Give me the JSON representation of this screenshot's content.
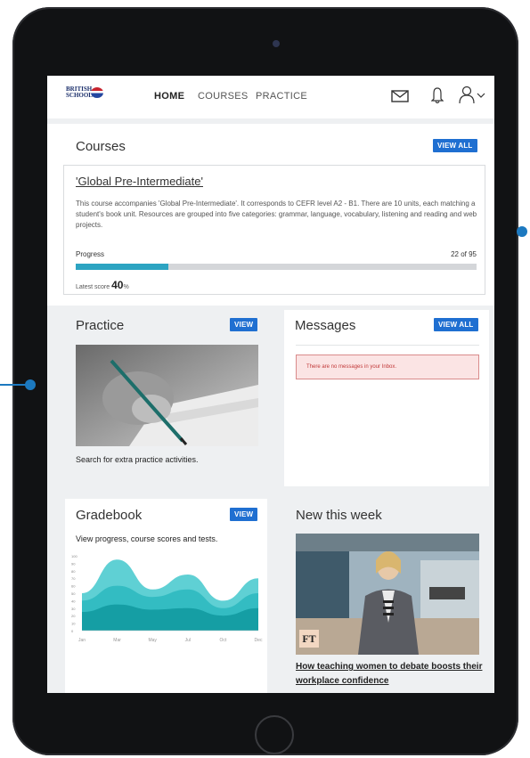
{
  "nav": {
    "logo_line1": "BRITISH",
    "logo_line2": "SCHOOL",
    "links": [
      "HOME",
      "COURSES",
      "PRACTICE"
    ]
  },
  "courses": {
    "title": "Courses",
    "view_all": "VIEW ALL",
    "course_name": "'Global Pre-Intermediate'",
    "description": "This course accompanies 'Global Pre-Intermediate'. It corresponds to CEFR level A2 - B1. There are 10 units, each matching a student's book unit. Resources are grouped into five categories: grammar, language, vocabulary, listening and reading and web projects.",
    "progress_label": "Progress",
    "progress_count": "22 of 95",
    "progress_fraction": 0.2316,
    "latest_score_label": "Latest score",
    "latest_score_value": "40",
    "latest_score_unit": "%"
  },
  "practice": {
    "title": "Practice",
    "view": "VIEW",
    "caption": "Search for extra practice activities."
  },
  "messages": {
    "title": "Messages",
    "view_all": "VIEW ALL",
    "empty_text": "There are no messages in your Inbox."
  },
  "gradebook": {
    "title": "Gradebook",
    "view": "VIEW",
    "caption": "View progress, course scores and tests."
  },
  "news": {
    "title": "New this week",
    "badge": "FT",
    "headline": "How teaching women to debate boosts their workplace confidence"
  },
  "chart_data": {
    "type": "area",
    "x": [
      "Jan",
      "Mar",
      "May",
      "Jul",
      "Oct",
      "Dec"
    ],
    "y_ticks": [
      0,
      10,
      20,
      30,
      40,
      50,
      60,
      70,
      80,
      90,
      100
    ],
    "ylim": [
      0,
      100
    ],
    "grid": false,
    "series": [
      {
        "values": [
          50,
          95,
          55,
          75,
          40,
          70
        ],
        "color": "#5fd0d4"
      },
      {
        "values": [
          40,
          60,
          45,
          55,
          30,
          50
        ],
        "color": "#33bcc2"
      },
      {
        "values": [
          25,
          35,
          28,
          30,
          20,
          30
        ],
        "color": "#159ea4"
      }
    ]
  },
  "colors": {
    "accent": "#1f6fd1",
    "progress": "#2da4c2",
    "alert_bg": "#fbe4e4",
    "alert_text": "#c23a3a"
  }
}
